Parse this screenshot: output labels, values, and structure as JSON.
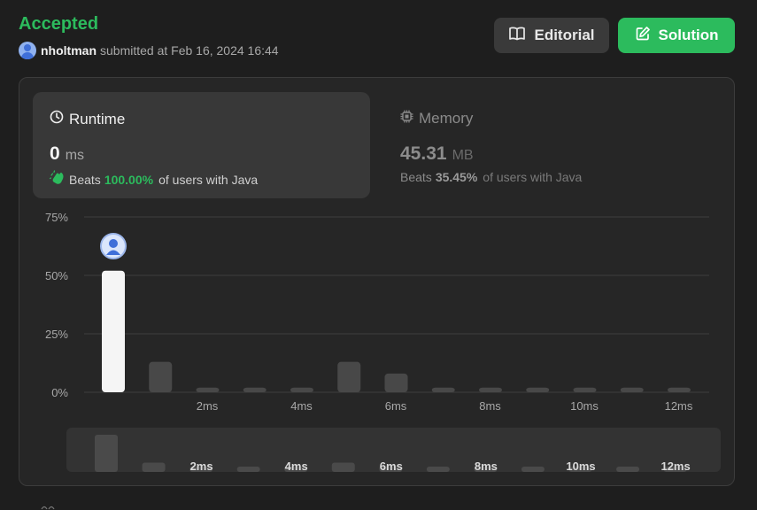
{
  "submission": {
    "status": "Accepted",
    "username": "nholtman",
    "submitted_text": "submitted at Feb 16, 2024 16:44"
  },
  "header_buttons": {
    "editorial_label": "Editorial",
    "editorial_icon": "book-icon",
    "solution_label": "Solution",
    "solution_icon": "edit-icon"
  },
  "runtime": {
    "title": "Runtime",
    "icon": "clock-icon",
    "value": "0",
    "unit": "ms",
    "beats_label": "Beats",
    "beats_pct": "100.00%",
    "beats_rest": "of users with Java",
    "selected": true
  },
  "memory": {
    "title": "Memory",
    "icon": "chip-icon",
    "value": "45.31",
    "unit": "MB",
    "beats_label": "Beats",
    "beats_pct": "35.45%",
    "beats_rest": "of users with Java",
    "selected": false
  },
  "colors": {
    "accepted_green": "#2cbb5d",
    "bar_highlight": "#f5f5f5",
    "bar_default": "#484848",
    "grid": "#3e3e3e"
  },
  "chart_data": {
    "type": "bar",
    "title": "",
    "xlabel": "",
    "ylabel": "",
    "ylim": [
      0,
      75
    ],
    "y_ticks": [
      "75%",
      "50%",
      "25%",
      "0%"
    ],
    "y_tick_values": [
      75,
      50,
      25,
      0
    ],
    "x_tick_labels": [
      "2ms",
      "4ms",
      "6ms",
      "8ms",
      "10ms",
      "12ms"
    ],
    "x_tick_values": [
      2,
      4,
      6,
      8,
      10,
      12
    ],
    "bins_ms": [
      0,
      1,
      2,
      3,
      4,
      5,
      6,
      7,
      8,
      9,
      10,
      11,
      12
    ],
    "values": [
      52,
      13,
      2,
      2,
      2,
      13,
      8,
      2,
      2,
      2,
      2,
      2,
      2
    ],
    "highlight_index": 0,
    "grid": true
  },
  "minimap": {
    "x_tick_labels": [
      "2ms",
      "4ms",
      "6ms",
      "8ms",
      "10ms",
      "12ms"
    ],
    "values": [
      52,
      13,
      2,
      2,
      2,
      13,
      8,
      2,
      2,
      2,
      2,
      2,
      2
    ]
  }
}
